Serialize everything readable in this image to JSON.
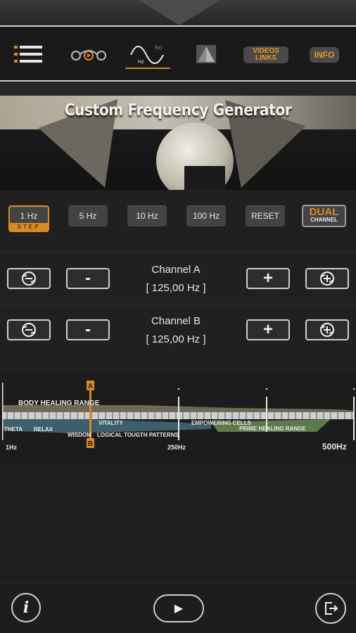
{
  "toolbar": {
    "icons": [
      "menu-icon",
      "binaural-icon",
      "frequency-wave-icon",
      "pyramid-icon"
    ],
    "freq_icon_labels": {
      "fx": "f(x)",
      "hz": "Hz"
    },
    "videos_line1": "VIDEOS",
    "videos_line2": "LINKS",
    "info": "INFO"
  },
  "header": {
    "title": "Custom Frequency Generator"
  },
  "steps": {
    "step_1": "1 Hz",
    "step_1_sub": "STEP",
    "step_5": "5 Hz",
    "step_10": "10 Hz",
    "step_100": "100 Hz",
    "reset": "RESET",
    "dual_line1": "DUAL",
    "dual_line2": "CHANNEL",
    "selected": "1 Hz"
  },
  "channels": [
    {
      "label": "Channel A",
      "value": "[ 125,00 Hz ]",
      "minus": "-",
      "plus": "+"
    },
    {
      "label": "Channel B",
      "value": "[ 125,00 Hz ]",
      "minus": "-",
      "plus": "+"
    }
  ],
  "spectrum": {
    "marker_a": "A",
    "marker_b": "B",
    "body_range": "BODY HEALING RANGE",
    "theta": "THETA",
    "relax": "RELAX",
    "vitality": "VITALITY",
    "wisdom": "WISDOM",
    "logical": "LOGICAL TOUGTH PATTERNS",
    "empowering": "EMPOWERING CELLS",
    "prime": "PRIME HEALING RANGE",
    "tick_min": "1Hz",
    "tick_mid": "250Hz",
    "tick_max": "500Hz",
    "marker_hz": 125,
    "max_hz": 500,
    "accent": "#d98a28"
  },
  "bottom": {
    "info": "i",
    "play": "▶",
    "icons": [
      "info-icon",
      "play-icon",
      "exit-icon"
    ]
  }
}
